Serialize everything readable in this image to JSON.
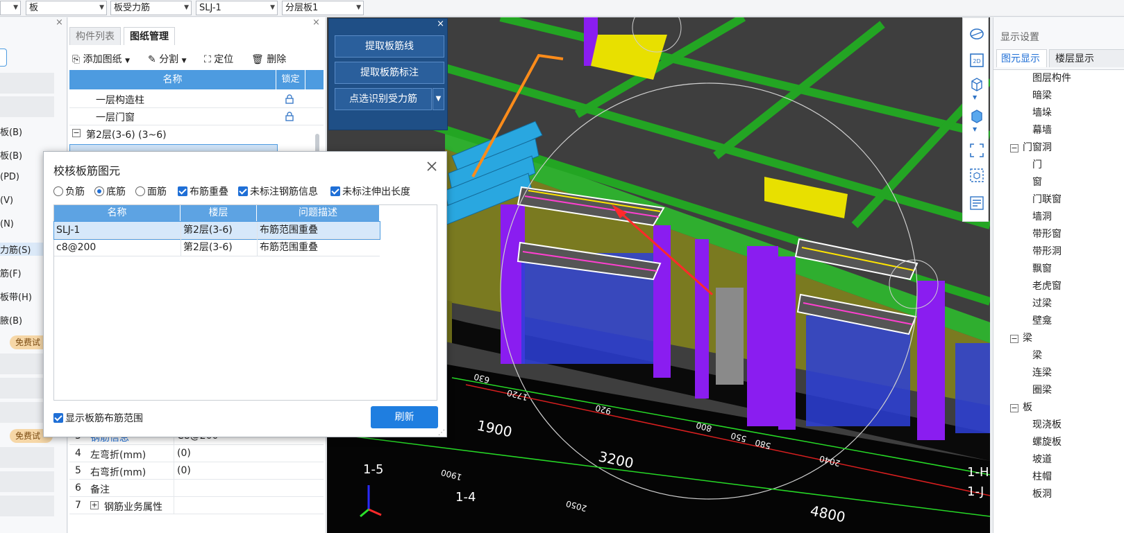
{
  "toolbar": {
    "selects": [
      {
        "value": "",
        "left": 0
      },
      {
        "value": "板"
      },
      {
        "value": "板受力筋"
      },
      {
        "value": "SLJ-1"
      },
      {
        "value": "分层板1"
      }
    ]
  },
  "left_column": {
    "items": [
      "板(B)",
      "板(B)",
      "(PD)",
      "(V)",
      "(N)",
      "力筋(S)",
      "筋(F)",
      "板带(H)",
      "腋(B)"
    ],
    "badge": "免费试",
    "badge2": "免费试"
  },
  "mid_panel": {
    "tabs": [
      "构件列表",
      "图纸管理"
    ],
    "actions": {
      "add": "添加图纸",
      "split": "分割",
      "locate": "定位",
      "delete": "删除"
    },
    "tree_headers": {
      "name": "名称",
      "lock": "锁定"
    },
    "tree_rows": [
      "一层构造柱",
      "一层门窗",
      "第2层(3-6) (3~6)"
    ],
    "props": [
      {
        "n": "3",
        "k": "钢筋信息",
        "v": "C8@200"
      },
      {
        "n": "4",
        "k": "左弯折(mm)",
        "v": "(0)"
      },
      {
        "n": "5",
        "k": "右弯折(mm)",
        "v": "(0)"
      },
      {
        "n": "6",
        "k": "备注",
        "v": ""
      },
      {
        "n": "7",
        "k": "钢筋业务属性",
        "v": ""
      }
    ]
  },
  "float_panel": {
    "btn1": "提取板筋线",
    "btn2": "提取板筋标注",
    "btn3": "点选识别受力筋"
  },
  "dialog": {
    "title": "校核板筋图元",
    "radios": [
      "负筋",
      "底筋",
      "面筋"
    ],
    "radio_selected": "底筋",
    "checks": [
      "布筋重叠",
      "未标注钢筋信息",
      "未标注伸出长度"
    ],
    "headers": {
      "name": "名称",
      "floor": "楼层",
      "desc": "问题描述"
    },
    "rows": [
      {
        "name": "SLJ-1",
        "floor": "第2层(3-6)",
        "desc": "布筋范围重叠"
      },
      {
        "name": "c8@200",
        "floor": "第2层(3-6)",
        "desc": "布筋范围重叠"
      }
    ],
    "show_range": "显示板筋布筋范围",
    "refresh": "刷新"
  },
  "right_panel": {
    "title": "显示设置",
    "tabs": [
      "图元显示",
      "楼层显示"
    ],
    "rows": [
      "图层构件",
      "暗梁",
      "墙垛",
      "幕墙",
      "门窗洞",
      "门",
      "窗",
      "门联窗",
      "墙洞",
      "带形窗",
      "带形洞",
      "飘窗",
      "老虎窗",
      "过梁",
      "壁龛",
      "梁",
      "梁",
      "连梁",
      "圈梁",
      "板",
      "现浇板",
      "螺旋板",
      "坡道",
      "柱帽",
      "板洞"
    ]
  },
  "viewport": {
    "dims": [
      "1900",
      "3200",
      "4800",
      "1720",
      "920",
      "630",
      "800",
      "550",
      "580",
      "2040",
      "1900",
      "2050"
    ],
    "axis_labels": [
      "1-5",
      "1-4",
      "1-H",
      "1-J"
    ],
    "rt_2d": "2D"
  },
  "colors": {
    "accent": "#1f6fd6",
    "float_bg": "#1f4f86",
    "header_blue": "#4d9be0"
  }
}
